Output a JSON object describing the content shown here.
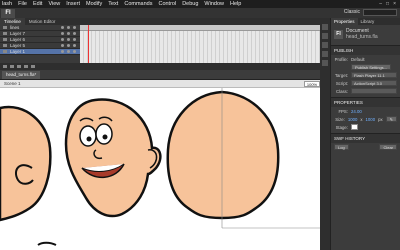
{
  "menu": {
    "app_partial": "lash",
    "items": [
      "File",
      "Edit",
      "View",
      "Insert",
      "Modify",
      "Text",
      "Commands",
      "Control",
      "Debug",
      "Window",
      "Help"
    ]
  },
  "toolbar": {
    "logo": "Fl",
    "workspace": "Classic"
  },
  "timeline": {
    "tabs": [
      "Timeline",
      "Motion Editor"
    ],
    "layers": [
      {
        "name": "lines",
        "selected": false
      },
      {
        "name": "Layer 7",
        "selected": false
      },
      {
        "name": "Layer 6",
        "selected": false
      },
      {
        "name": "Layer 5",
        "selected": false
      },
      {
        "name": "Layer 1",
        "selected": true
      }
    ]
  },
  "document": {
    "tab": "head_turns.fla*",
    "scene": "Scene 1",
    "zoom": "100%"
  },
  "properties": {
    "tabs": [
      "Properties",
      "Library"
    ],
    "doc_label": "Document",
    "doc_name": "head_turns.fla",
    "publish_section": "PUBLISH",
    "profile_label": "Profile:",
    "profile_value": "Default",
    "publish_settings_btn": "Publish Settings...",
    "target_label": "Target:",
    "target_value": "Flash Player 11.1",
    "script_label": "Script:",
    "script_value": "ActionScript 3.0",
    "class_label": "Class:",
    "properties_section": "PROPERTIES",
    "fps_label": "FPS:",
    "fps_value": "24.00",
    "size_label": "Size:",
    "size_w": "1000",
    "size_h": "1000",
    "size_unit": "px",
    "stage_label": "Stage:",
    "swf_section": "SWF HISTORY",
    "log_btn": "Log",
    "clear_btn": "Clear"
  },
  "colors": {
    "skin": "#f7c39a",
    "outline": "#111111",
    "selected_layer": "#5573a8"
  }
}
